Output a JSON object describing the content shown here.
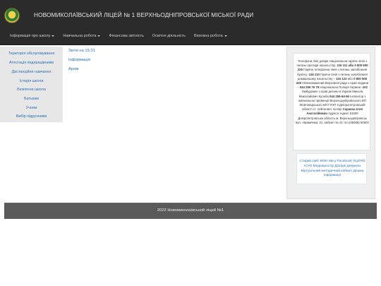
{
  "header": {
    "title": "НОВОМИКОЛАЇВСЬКИЙ ЛІЦЕЙ № 1 ВЕРХНЬОДНІПРОВСЬКОЇ МІСЬКОЇ РАДИ",
    "logo_icon": "school-emblem-icon"
  },
  "nav": {
    "items": [
      {
        "label": "Інформація про школу",
        "dropdown": true
      },
      {
        "label": "Навчальна робота",
        "dropdown": true
      },
      {
        "label": "Фінансова звітність",
        "dropdown": false
      },
      {
        "label": "Освітня діяльність",
        "dropdown": false
      },
      {
        "label": "Виховна робота",
        "dropdown": true
      }
    ]
  },
  "sidebar": {
    "items": [
      {
        "label": "Територія обслуговування"
      },
      {
        "label": "Атестація педпрацівників"
      },
      {
        "label": "Дистанційне навчання"
      },
      {
        "label": "Історія школи"
      },
      {
        "label": "Безпечна школа"
      },
      {
        "label": "Батькам"
      },
      {
        "label": "Учням"
      },
      {
        "label": "Вибір підручників"
      }
    ]
  },
  "main": {
    "links": [
      {
        "label": "Звіти на 15.01"
      },
      {
        "label": "Інформація"
      },
      {
        "label": "Архів"
      }
    ]
  },
  "right_panel": {
    "info": {
      "p1": "Телефони лінії довіри Національна гаряча",
      "p2": "лінія з питань протидії насильству: ",
      "hotline1": "116 111 або 0 800 500 225",
      "p3": " Гаряча телефонна лінія з питань запобігання булінгу ",
      "hotline2": "-116 110",
      "p4": " Гаряча лінія з питань запобігання домашньому насильству – ",
      "hotline3": "116 123",
      "p5": " або ",
      "hotline4": "0 800 500 335",
      "p6": " Уповноважений Верховної ради з прав людини – ",
      "hotline5": "044 255 76 76",
      "p7": " Національна Поліція України ",
      "hotline6": "-102",
      "p8": " Омбудсмен з прав дитини в Україні Микола Миколайович Кулеба ",
      "hotline7": "044 255-64-56",
      "p9": " Інспектор з ювенальної превенції Верхньодніпровського ВП Жовтоводського ВП ГУНП в Дніпропетровській області ст. лейтенант поліції ",
      "inspector": "Саранча Ілля Анатолійович",
      "p10": " Адреса: індекс 51600 Дніпропетровська область м. Верхньодніпровськ вул. Аврамчика, 21, кабінет № 21 тел.(05658) 60602"
    },
    "links": "Старий сайт МОН Ми у Facebook УЦОЯО ІСУО Медіапростір Дохідні джерела Віртуальний методичний кабінет Дошка інформації"
  },
  "footer": {
    "text": "2022 Новомиколаївський ліцей №1"
  }
}
